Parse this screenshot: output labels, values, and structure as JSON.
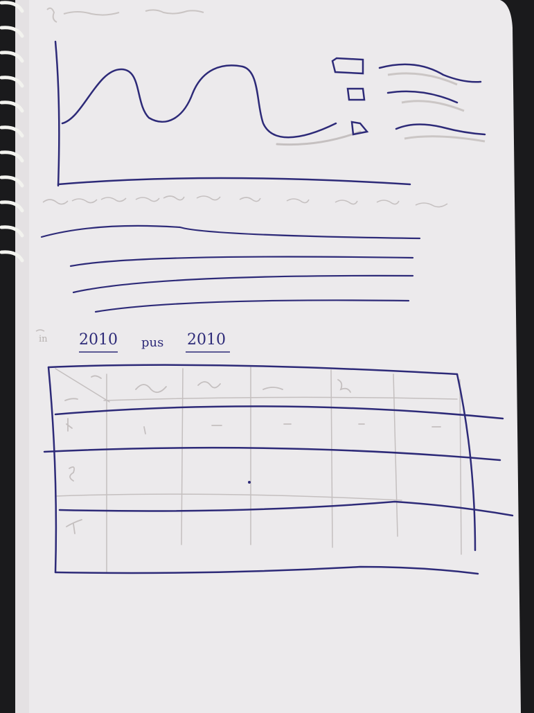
{
  "sketch": {
    "filter_row": {
      "from_label": "in",
      "from_value": "2010",
      "mid_label": "pus",
      "to_value": "2010"
    }
  },
  "colors": {
    "paper": "#eceaec",
    "ink": "#2d2a78",
    "pencil": "#b8b2b2",
    "background": "#1a1a1c",
    "binding_ring": "#f2f2ef"
  }
}
